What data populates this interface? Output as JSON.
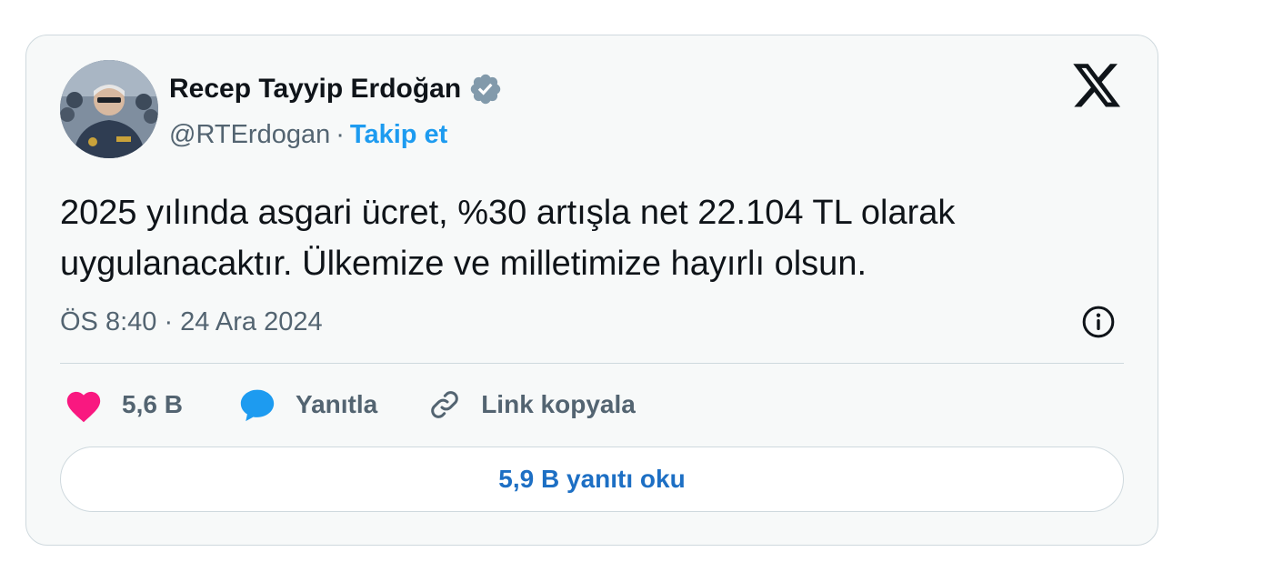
{
  "author": {
    "name": "Recep Tayyip Erdoğan",
    "handle": "@RTErdogan",
    "separator": "·",
    "follow_label": "Takip et"
  },
  "icons": {
    "verified": "verified-badge-icon",
    "brand": "x-logo-icon",
    "info": "info-icon",
    "like": "heart-icon",
    "reply": "speech-bubble-icon",
    "copy": "link-icon"
  },
  "tweet": {
    "text_line_1": "2025 yılında asgari ücret, %30 artışla net 22.104 TL olarak",
    "text_line_2": "uygulanacaktır. Ülkemize ve milletimize hayırlı olsun.",
    "timestamp": "ÖS 8:40 · 24 Ara 2024"
  },
  "actions": {
    "like_count": "5,6 B",
    "reply_label": "Yanıtla",
    "copy_link_label": "Link kopyala"
  },
  "replies_button": {
    "label": "5,9 B yanıtı oku"
  },
  "colors": {
    "accent_blue": "#1d9bf0",
    "like_pink": "#f91880",
    "text_primary": "#0f1419",
    "text_secondary": "#536471",
    "border": "#cfd9de",
    "card_bg": "#f7f9f9"
  }
}
